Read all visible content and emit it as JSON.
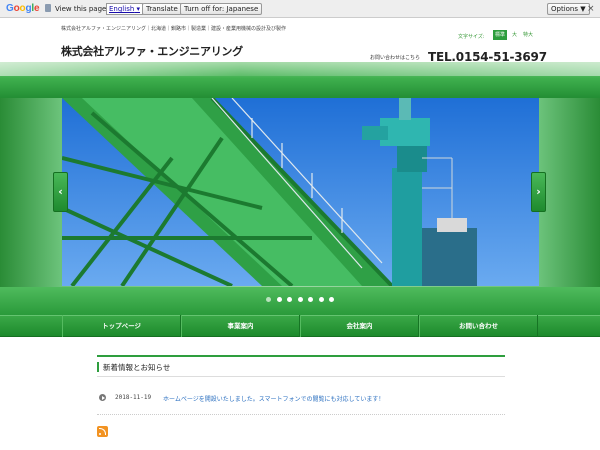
{
  "translate_bar": {
    "logo": "Google",
    "view_text": "View this page in:",
    "language": "English",
    "translate_label": "Translate",
    "turn_off_label": "Turn off for: Japanese",
    "options_label": "Options ▼",
    "close": "×"
  },
  "header": {
    "tagline": "株式会社アルファ・エンジニアリング｜北海道｜釧路市｜製造業｜建設・産業用機械の設計及び製作",
    "site_name": "株式会社アルファ・エンジニアリング",
    "font_size_label": "文字サイズ:",
    "font_sizes": [
      "標準",
      "大",
      "特大"
    ],
    "contact_label": "お問い合わせはこちら",
    "tel": "TEL.0154-51-3697"
  },
  "slider": {
    "prev": "‹",
    "next": "›",
    "dot_count": 7,
    "active_index": 0
  },
  "nav": {
    "items": [
      "トップページ",
      "事業案内",
      "会社案内",
      "お問い合わせ"
    ]
  },
  "news": {
    "title": "新着情報とお知らせ",
    "items": [
      {
        "date": "2018-11-19",
        "text": "ホームページを開設いたしました。スマートフォンでの閲覧にも対応しています！"
      }
    ]
  },
  "colors": {
    "brand_green": "#2e9e3e",
    "link_blue": "#2a6fc0",
    "rss_orange": "#f29322"
  }
}
